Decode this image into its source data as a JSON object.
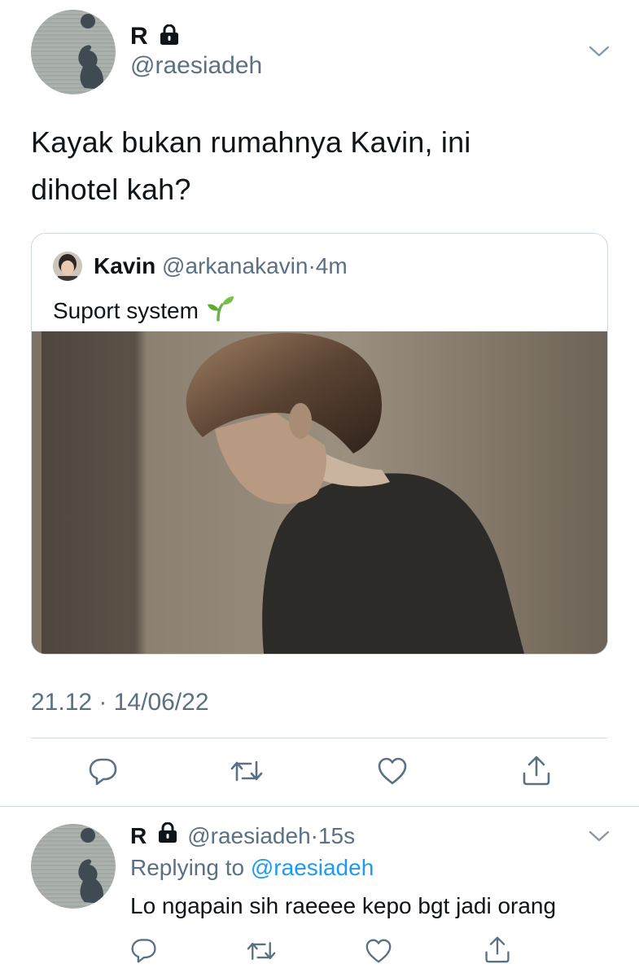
{
  "main_tweet": {
    "display_name": "R",
    "handle": "@raesiadeh",
    "text_line1": "Kayak bukan rumahnya Kavin, ini",
    "text_line2": "dihotel kah?",
    "timestamp": "21.12 · 14/06/22",
    "icons": [
      "lock-icon",
      "chevron-down-icon"
    ]
  },
  "quoted_tweet": {
    "display_name": "Kavin",
    "handle": "@arkanakavin",
    "separator": "·",
    "time": "4m",
    "text": "Suport system",
    "emoji": "seedling-icon"
  },
  "actions": [
    "reply-icon",
    "retweet-icon",
    "like-icon",
    "share-icon"
  ],
  "reply_tweet": {
    "display_name": "R",
    "handle": "@raesiadeh",
    "separator": "·",
    "time": "15s",
    "replying_prefix": "Replying to",
    "replying_to": "@raesiadeh",
    "text": "Lo ngapain sih raeeee kepo bgt jadi orang"
  },
  "colors": {
    "text": "#0f1419",
    "secondary": "#5b7083",
    "link": "#1d9bf0",
    "divider": "#cfd9de"
  }
}
